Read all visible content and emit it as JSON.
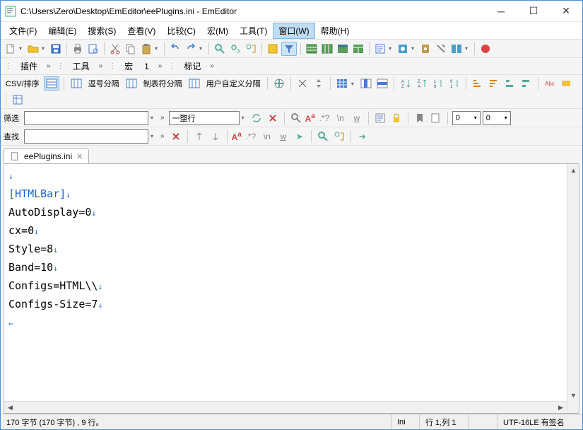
{
  "title": "C:\\Users\\Zero\\Desktop\\EmEditor\\eePlugins.ini - EmEditor",
  "menubar": [
    {
      "label": "文件(F)",
      "active": false
    },
    {
      "label": "编辑(E)",
      "active": false
    },
    {
      "label": "搜索(S)",
      "active": false
    },
    {
      "label": "查看(V)",
      "active": false
    },
    {
      "label": "比较(C)",
      "active": false
    },
    {
      "label": "宏(M)",
      "active": false
    },
    {
      "label": "工具(T)",
      "active": false
    },
    {
      "label": "窗口(W)",
      "active": true
    },
    {
      "label": "帮助(H)",
      "active": false
    }
  ],
  "tabbar": [
    {
      "label": "插件"
    },
    {
      "label": "工具"
    },
    {
      "label": "宏"
    },
    {
      "label": "标记"
    }
  ],
  "tabbar_macro_num": "1",
  "csv": {
    "title": "CSV/排序",
    "buttons": [
      "逗号分隔",
      "制表符分隔",
      "用户自定义分隔"
    ]
  },
  "filter": {
    "label": "筛选",
    "value": "",
    "combo": "一整行",
    "spin1": "0",
    "spin2": "0"
  },
  "find": {
    "label": "查找",
    "value": ""
  },
  "file_tab": {
    "name": "eePlugins.ini"
  },
  "editor_lines": [
    {
      "text": "",
      "section": false
    },
    {
      "text": "[HTMLBar]",
      "section": true
    },
    {
      "text": "AutoDisplay=0",
      "section": false
    },
    {
      "text": "cx=0",
      "section": false
    },
    {
      "text": "Style=8",
      "section": false
    },
    {
      "text": "Band=10",
      "section": false
    },
    {
      "text": "Configs=HTML\\\\",
      "section": false
    },
    {
      "text": "Configs-Size=7",
      "section": false
    }
  ],
  "eof_marker": "←",
  "eol_marker": "↓",
  "status": {
    "left": "170 字节 (170 字节) , 9 行。",
    "filetype": "Ini",
    "pos": "行 1,列 1",
    "encoding": "UTF-16LE 有签名"
  },
  "colors": {
    "accent": "#4a90d9",
    "section": "#1e5fcc",
    "eol": "#1e6fd6"
  }
}
